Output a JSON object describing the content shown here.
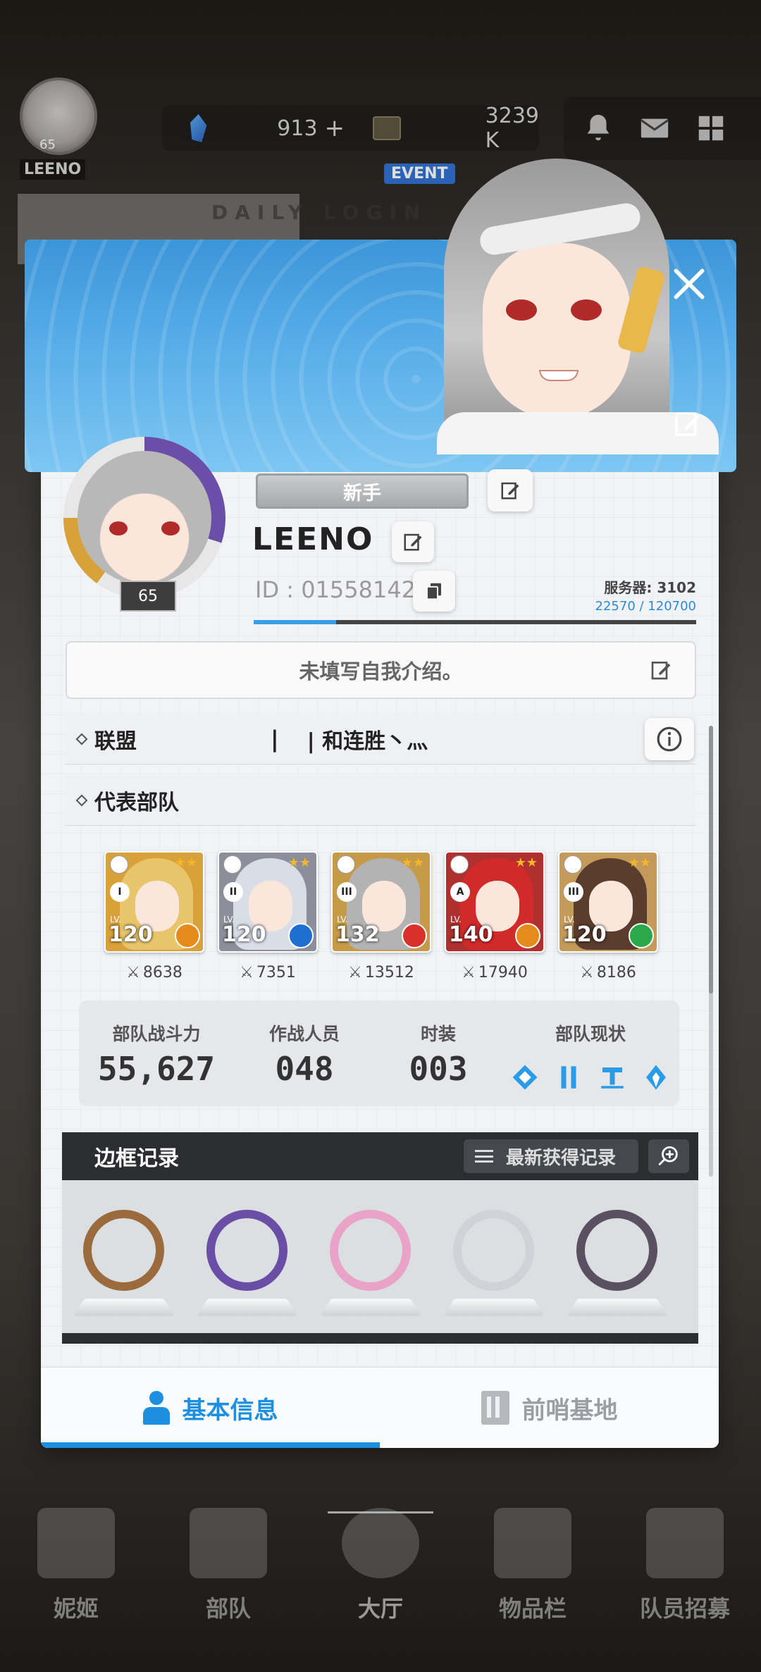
{
  "topbar": {
    "avatar_level": "65",
    "avatar_name": "LEENO",
    "gems": "913",
    "plus": "+",
    "credits": "3239 K",
    "event_tag": "EVENT",
    "daily_login": "DAILY LOGIN"
  },
  "profile": {
    "title_badge": "新手",
    "name": "LEENO",
    "id_label": "ID : 01558142",
    "level": "65",
    "server": "服务器:  3102",
    "exp": "22570 / 120700",
    "exp_progress": 0.187,
    "intro": "未填写自我介绍。"
  },
  "league": {
    "title": "联盟",
    "pipe": "|",
    "name": "| 和连胜丶灬"
  },
  "squad": {
    "title": "代表部队",
    "units": [
      {
        "burst": "I",
        "level": "120",
        "lv": "LV.",
        "power": "8638",
        "hair": "#e8c46a",
        "bg": "#d9a13a",
        "element": "#e48b1a"
      },
      {
        "burst": "II",
        "level": "120",
        "lv": "LV.",
        "power": "7351",
        "hair": "#d8dde6",
        "bg": "#8c8f9a",
        "element": "#1f6fd1"
      },
      {
        "burst": "III",
        "level": "132",
        "lv": "LV.",
        "power": "13512",
        "hair": "#b3b3b3",
        "bg": "#c59a48",
        "element": "#d8312b"
      },
      {
        "burst": "A",
        "level": "140",
        "lv": "LV.",
        "power": "17940",
        "hair": "#d02a2a",
        "bg": "#b03030",
        "element": "#e48b1a"
      },
      {
        "burst": "III",
        "level": "120",
        "lv": "LV.",
        "power": "8186",
        "hair": "#5a3d2c",
        "bg": "#c49a5a",
        "element": "#2ba84a"
      }
    ]
  },
  "stats": {
    "power_label": "部队战斗力",
    "power_value": "55,627",
    "members_label": "作战人员",
    "members_value": "048",
    "costume_label": "时装",
    "costume_value": "003",
    "status_label": "部队现状"
  },
  "frames": {
    "title": "边框记录",
    "latest_label": "最新获得记录",
    "items": [
      {
        "color": "#9b6b3e"
      },
      {
        "color": "#6a4ea6"
      },
      {
        "color": "#e8a3c6"
      },
      {
        "color": "#cfd3d8"
      },
      {
        "color": "#5b5060"
      }
    ]
  },
  "tabs": {
    "basic": "基本信息",
    "outpost": "前哨基地"
  },
  "bottom_nav": {
    "nikke": "妮姬",
    "squad": "部队",
    "lobby": "大厅",
    "inventory": "物品栏",
    "recruit": "队员招募"
  },
  "colors": {
    "accent": "#1d8fe0",
    "banner": "#5bb0ea"
  }
}
